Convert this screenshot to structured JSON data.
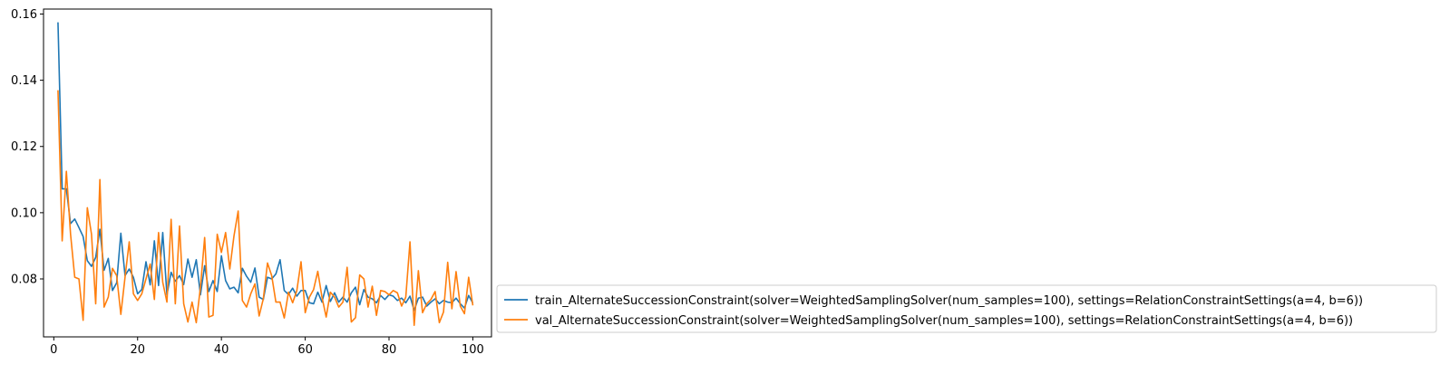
{
  "chart_data": {
    "type": "line",
    "title": "",
    "xlabel": "",
    "ylabel": "",
    "xlim": [
      -2.45,
      104.45
    ],
    "ylim": [
      0.0625,
      0.1615
    ],
    "xticks": [
      0,
      20,
      40,
      60,
      80,
      100
    ],
    "yticks": [
      0.08,
      0.1,
      0.12,
      0.14,
      0.16
    ],
    "xtick_labels": [
      "0",
      "20",
      "40",
      "60",
      "80",
      "100"
    ],
    "ytick_labels": [
      "0.08",
      "0.10",
      "0.12",
      "0.14",
      "0.16"
    ],
    "grid": false,
    "legend_placement": "outside-lower-right",
    "x": [
      1,
      2,
      3,
      4,
      5,
      6,
      7,
      8,
      9,
      10,
      11,
      12,
      13,
      14,
      15,
      16,
      17,
      18,
      19,
      20,
      21,
      22,
      23,
      24,
      25,
      26,
      27,
      28,
      29,
      30,
      31,
      32,
      33,
      34,
      35,
      36,
      37,
      38,
      39,
      40,
      41,
      42,
      43,
      44,
      45,
      46,
      47,
      48,
      49,
      50,
      51,
      52,
      53,
      54,
      55,
      56,
      57,
      58,
      59,
      60,
      61,
      62,
      63,
      64,
      65,
      66,
      67,
      68,
      69,
      70,
      71,
      72,
      73,
      74,
      75,
      76,
      77,
      78,
      79,
      80,
      81,
      82,
      83,
      84,
      85,
      86,
      87,
      88,
      89,
      90,
      91,
      92,
      93,
      94,
      95,
      96,
      97,
      98,
      99,
      100
    ],
    "series": [
      {
        "name": "train_AlternateSuccessionConstraint(solver=WeightedSamplingSolver(num_samples=100), settings=RelationConstraintSettings(a=4, b=6))",
        "color": "#1f77b4",
        "values": [
          0.1575,
          0.1072,
          0.1072,
          0.0967,
          0.0981,
          0.0955,
          0.0928,
          0.0855,
          0.0838,
          0.0865,
          0.095,
          0.0826,
          0.0862,
          0.0765,
          0.0788,
          0.0938,
          0.081,
          0.083,
          0.0805,
          0.0755,
          0.0768,
          0.0852,
          0.0782,
          0.0915,
          0.078,
          0.094,
          0.0752,
          0.082,
          0.0793,
          0.081,
          0.0783,
          0.086,
          0.0805,
          0.0858,
          0.0752,
          0.084,
          0.0762,
          0.0795,
          0.0762,
          0.087,
          0.0795,
          0.077,
          0.0775,
          0.0758,
          0.0832,
          0.0808,
          0.079,
          0.0833,
          0.0745,
          0.0738,
          0.0805,
          0.08,
          0.0815,
          0.0858,
          0.0765,
          0.0753,
          0.0772,
          0.0748,
          0.0765,
          0.0765,
          0.0728,
          0.0725,
          0.076,
          0.073,
          0.078,
          0.0732,
          0.0758,
          0.073,
          0.0745,
          0.073,
          0.0758,
          0.0775,
          0.0722,
          0.0768,
          0.0745,
          0.074,
          0.0728,
          0.075,
          0.0738,
          0.0752,
          0.0748,
          0.0735,
          0.0742,
          0.0728,
          0.0748,
          0.0705,
          0.0742,
          0.0745,
          0.0718,
          0.073,
          0.074,
          0.0725,
          0.0735,
          0.073,
          0.0728,
          0.0742,
          0.0725,
          0.0712,
          0.075,
          0.0727
        ]
      },
      {
        "name": "val_AlternateSuccessionConstraint(solver=WeightedSamplingSolver(num_samples=100), settings=RelationConstraintSettings(a=4, b=6))",
        "color": "#ff7f0e",
        "values": [
          0.137,
          0.0915,
          0.1125,
          0.0935,
          0.0805,
          0.08,
          0.0675,
          0.1015,
          0.0935,
          0.0725,
          0.11,
          0.0715,
          0.0745,
          0.0832,
          0.081,
          0.0693,
          0.0805,
          0.0912,
          0.0755,
          0.0735,
          0.0755,
          0.08,
          0.0845,
          0.0738,
          0.094,
          0.079,
          0.073,
          0.098,
          0.0725,
          0.096,
          0.0725,
          0.067,
          0.073,
          0.0668,
          0.0775,
          0.0925,
          0.0685,
          0.069,
          0.0935,
          0.088,
          0.094,
          0.083,
          0.093,
          0.1005,
          0.0735,
          0.0715,
          0.0755,
          0.0785,
          0.0688,
          0.074,
          0.0848,
          0.081,
          0.073,
          0.073,
          0.0682,
          0.076,
          0.0728,
          0.0765,
          0.0852,
          0.0698,
          0.0745,
          0.0768,
          0.0823,
          0.0745,
          0.0685,
          0.076,
          0.0745,
          0.0715,
          0.073,
          0.0835,
          0.067,
          0.0683,
          0.0812,
          0.08,
          0.0715,
          0.0778,
          0.069,
          0.0765,
          0.0762,
          0.0752,
          0.0765,
          0.0758,
          0.0718,
          0.0745,
          0.0912,
          0.066,
          0.0825,
          0.0698,
          0.0725,
          0.0738,
          0.0762,
          0.0668,
          0.07,
          0.085,
          0.071,
          0.0822,
          0.0718,
          0.0695,
          0.0805,
          0.072
        ]
      }
    ]
  }
}
